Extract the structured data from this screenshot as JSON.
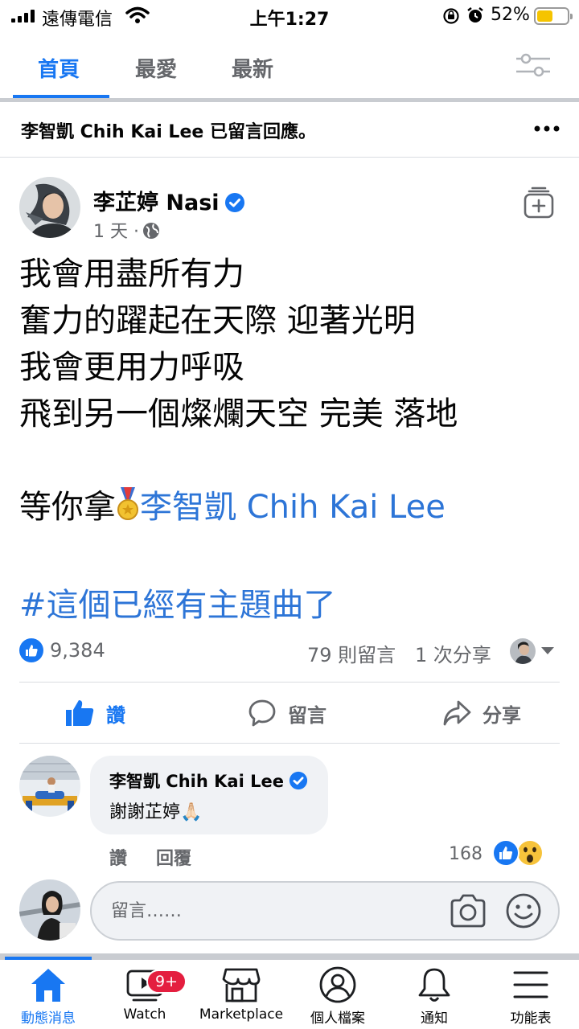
{
  "status_bar": {
    "carrier": "遠傳電信",
    "time": "上午1:27",
    "battery_percent": "52%",
    "battery_level": 0.52
  },
  "tabs": [
    {
      "label": "首頁",
      "active": true
    },
    {
      "label": "最愛",
      "active": false
    },
    {
      "label": "最新",
      "active": false
    }
  ],
  "notice": {
    "text": "李智凱 Chih Kai Lee 已留言回應。"
  },
  "post": {
    "author": "李芷婷 Nasi",
    "time": "1 天 ·",
    "lines": [
      "我會用盡所有力",
      "奮力的躍起在天際 迎著光明",
      "我會更用力呼吸",
      "飛到另一個燦爛天空 完美 落地"
    ],
    "dedication_prefix": "等你拿",
    "mention": "李智凱 Chih Kai Lee",
    "hashtag": "#這個已經有主題曲了"
  },
  "stats": {
    "likes": "9,384",
    "comments": "79 則留言",
    "shares": "1 次分享"
  },
  "actions": {
    "like": "讚",
    "comment": "留言",
    "share": "分享"
  },
  "comment": {
    "author": "李智凱 Chih Kai Lee",
    "text": "謝謝芷婷🙏🏻",
    "like_label": "讚",
    "reply_label": "回覆",
    "reaction_count": "168"
  },
  "comment_input": {
    "placeholder": "留言……"
  },
  "bottom_nav": {
    "items": [
      {
        "label": "動態消息",
        "icon": "home-icon",
        "active": true
      },
      {
        "label": "Watch",
        "icon": "watch-icon",
        "active": false
      },
      {
        "label": "Marketplace",
        "icon": "marketplace-icon",
        "active": false
      },
      {
        "label": "個人檔案",
        "icon": "profile-icon",
        "active": false
      },
      {
        "label": "通知",
        "icon": "bell-icon",
        "active": false
      },
      {
        "label": "功能表",
        "icon": "menu-icon",
        "active": false
      }
    ],
    "watch_badge": "9+"
  },
  "colors": {
    "accent": "#1877f2",
    "link": "#2d75d7",
    "badge": "#e41e3f"
  }
}
